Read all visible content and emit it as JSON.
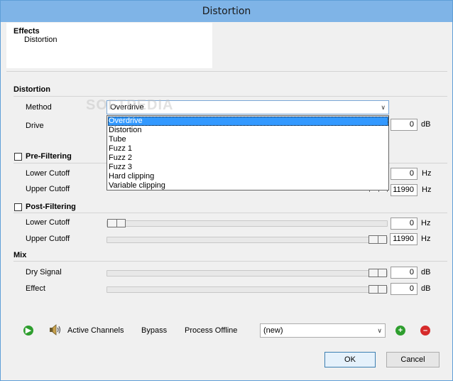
{
  "window": {
    "title": "Distortion"
  },
  "header": {
    "effects_title": "Effects",
    "effects_item": "Distortion"
  },
  "distortion": {
    "section_title": "Distortion",
    "method_label": "Method",
    "method_value": "Overdrive",
    "drive_label": "Drive",
    "drive_value": "0",
    "drive_unit": "dB",
    "method_options": [
      "Overdrive",
      "Distortion",
      "Tube",
      "Fuzz 1",
      "Fuzz 2",
      "Fuzz 3",
      "Hard clipping",
      "Variable clipping"
    ]
  },
  "pre_filtering": {
    "section_title": "Pre-Filtering",
    "checked": false,
    "lower_label": "Lower Cutoff",
    "lower_value": "0",
    "lower_unit": "Hz",
    "upper_label": "Upper Cutoff",
    "upper_value": "11990",
    "upper_unit": "Hz"
  },
  "post_filtering": {
    "section_title": "Post-Filtering",
    "checked": false,
    "lower_label": "Lower Cutoff",
    "lower_value": "0",
    "lower_unit": "Hz",
    "lower_level": 0.0,
    "upper_label": "Upper Cutoff",
    "upper_value": "11990",
    "upper_unit": "Hz",
    "upper_level": 1.0
  },
  "mix": {
    "section_title": "Mix",
    "dry_label": "Dry Signal",
    "dry_value": "0",
    "dry_unit": "dB",
    "dry_level": 1.0,
    "effect_label": "Effect",
    "effect_value": "0",
    "effect_unit": "dB",
    "effect_level": 1.0
  },
  "toolbar": {
    "active_channels": "Active Channels",
    "bypass": "Bypass",
    "process_offline": "Process Offline",
    "preset_value": "(new)",
    "play_icon": "play-icon",
    "speaker_icon": "speaker-icon",
    "add_icon": "add-icon",
    "remove_icon": "remove-icon"
  },
  "footer": {
    "ok": "OK",
    "cancel": "Cancel"
  },
  "watermark": "SOFTPEDIA",
  "colors": {
    "titlebar": "#7fb4e7",
    "selection": "#3399ff",
    "play": "#2e9e2e",
    "remove": "#d62b2b"
  }
}
